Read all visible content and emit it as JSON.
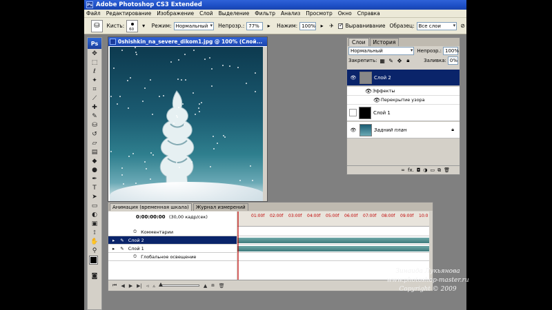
{
  "app": {
    "title": "Adobe Photoshop CS3 Extended",
    "ps_logo": "Ps"
  },
  "menu": [
    "Файл",
    "Редактирование",
    "Изображение",
    "Слой",
    "Выделение",
    "Фильтр",
    "Анализ",
    "Просмотр",
    "Окно",
    "Справка"
  ],
  "options": {
    "brush_label": "Кисть:",
    "brush_size": "60",
    "mode_label": "Режим:",
    "mode_value": "Нормальный",
    "opacity_label": "Непрозр.:",
    "opacity_value": "77%",
    "flow_label": "Нажим:",
    "flow_value": "100%",
    "align_label": "Выравнивание",
    "sample_label": "Образец:",
    "sample_value": "Все слои"
  },
  "document": {
    "title": "0shishkin_na_severe_dikom1.jpg @ 100% (Слой..."
  },
  "layers": {
    "tabs": [
      "Слои",
      "История"
    ],
    "blend_mode": "Нормальный",
    "opacity_label": "Непрозр.:",
    "opacity_value": "100%",
    "lock_label": "Закрепить:",
    "fill_label": "Заливка:",
    "fill_value": "0%",
    "items": [
      {
        "name": "Слой 2"
      },
      {
        "name": "Эффекты"
      },
      {
        "name": "Перекрытие узора"
      },
      {
        "name": "Слой 1"
      },
      {
        "name": "Задний план"
      }
    ],
    "footer_icons": [
      "link-icon",
      "fx",
      "mask-icon",
      "adjustment-icon",
      "folder-icon",
      "new-layer-icon",
      "trash-icon"
    ],
    "footer_fx": "fx."
  },
  "animation": {
    "tabs": [
      "Анимация (временная шкала)",
      "Журнал измерений"
    ],
    "timecode": "0:00:00:00",
    "fps": "(30,00 кадр/сек)",
    "ruler": [
      "01:00f",
      "02:00f",
      "03:00f",
      "04:00f",
      "05:00f",
      "06:00f",
      "07:00f",
      "08:00f",
      "09:00f",
      "10:0"
    ],
    "rows": [
      {
        "label": "Комментарии"
      },
      {
        "label": "Слой 2"
      },
      {
        "label": "Слой 1"
      },
      {
        "label": "Глобальное освещение"
      }
    ]
  },
  "watermark": {
    "line1": "Зинаида Лукьянова",
    "line2": "www.photoshop-master.ru",
    "line3": "Copyright © 2009"
  }
}
